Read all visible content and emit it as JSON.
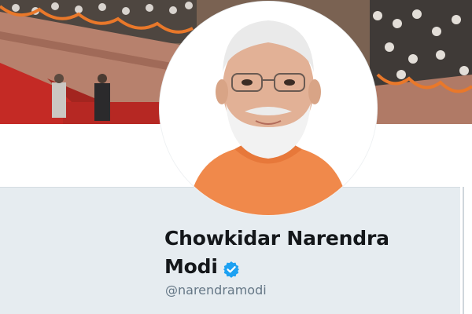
{
  "profile": {
    "display_name_line1": "Chowkidar Narendra",
    "display_name_line2": "Modi",
    "handle": "@narendramodi",
    "verified": true
  },
  "icons": {
    "verified": "verified-badge-icon"
  },
  "colors": {
    "verified_blue": "#1da1f2",
    "name_text": "#14171a",
    "handle_text": "#657786",
    "card_background": "#e6ecf0"
  }
}
